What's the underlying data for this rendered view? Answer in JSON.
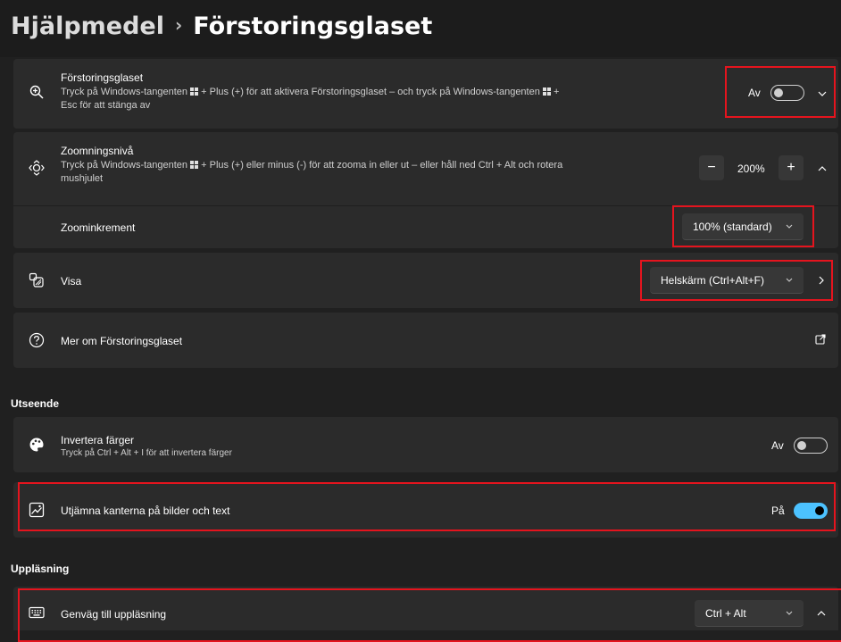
{
  "header": {
    "breadcrumb_parent": "Hjälpmedel",
    "separator": "›",
    "page_title": "Förstoringsglaset"
  },
  "magnifier": {
    "title": "Förstoringsglaset",
    "desc_line1_a": "Tryck på Windows-tangenten",
    "desc_line1_b": "+ Plus (+) för att aktivera Förstoringsglaset – och tryck på Windows-tangenten",
    "desc_line1_c": "+",
    "desc_line2": "Esc för att stänga av",
    "state_label": "Av",
    "toggle_on": false
  },
  "zoom_level": {
    "title": "Zoomningsnivå",
    "desc_line1_a": "Tryck på Windows-tangenten",
    "desc_line1_b": "+ Plus (+) eller minus (-) för att zooma in eller ut – eller håll ned Ctrl + Alt och rotera",
    "desc_line2": "mushjulet",
    "minus": "−",
    "value": "200%",
    "plus": "+"
  },
  "zoom_increment": {
    "title": "Zoominkrement",
    "selected": "100% (standard)"
  },
  "view": {
    "title": "Visa",
    "selected": "Helskärm (Ctrl+Alt+F)"
  },
  "learn_more": {
    "title": "Mer om Förstoringsglaset"
  },
  "appearance": {
    "section_label": "Utseende",
    "invert": {
      "title": "Invertera färger",
      "desc": "Tryck på Ctrl + Alt + I för att invertera färger",
      "state_label": "Av",
      "toggle_on": false
    },
    "smooth": {
      "title": "Utjämna kanterna på bilder och text",
      "state_label": "På",
      "toggle_on": true
    }
  },
  "reading": {
    "section_label": "Uppläsning",
    "shortcut": {
      "title": "Genväg till uppläsning",
      "selected": "Ctrl + Alt"
    }
  },
  "colors": {
    "background": "#202020",
    "card": "#2b2b2b",
    "accent": "#4cc2ff",
    "highlight": "#e5141e"
  }
}
